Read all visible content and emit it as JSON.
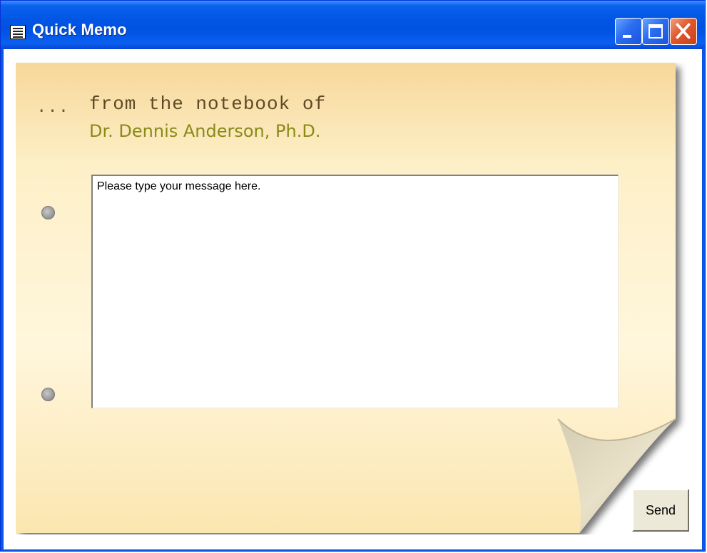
{
  "window": {
    "title": "Quick Memo",
    "icon": "notepad-icon",
    "controls": {
      "minimize": "minimize-icon",
      "maximize": "maximize-icon",
      "close": "close-icon"
    }
  },
  "memo": {
    "leader": "...",
    "heading": "from the notebook of",
    "author": "Dr. Dennis Anderson, Ph.D.",
    "message_value": "Please type your message here.",
    "send_label": "Send"
  },
  "colors": {
    "titlebar": "#0255e4",
    "paper": "#fdf0c8",
    "author_text": "#8a8a18",
    "close_button": "#e0582c"
  }
}
